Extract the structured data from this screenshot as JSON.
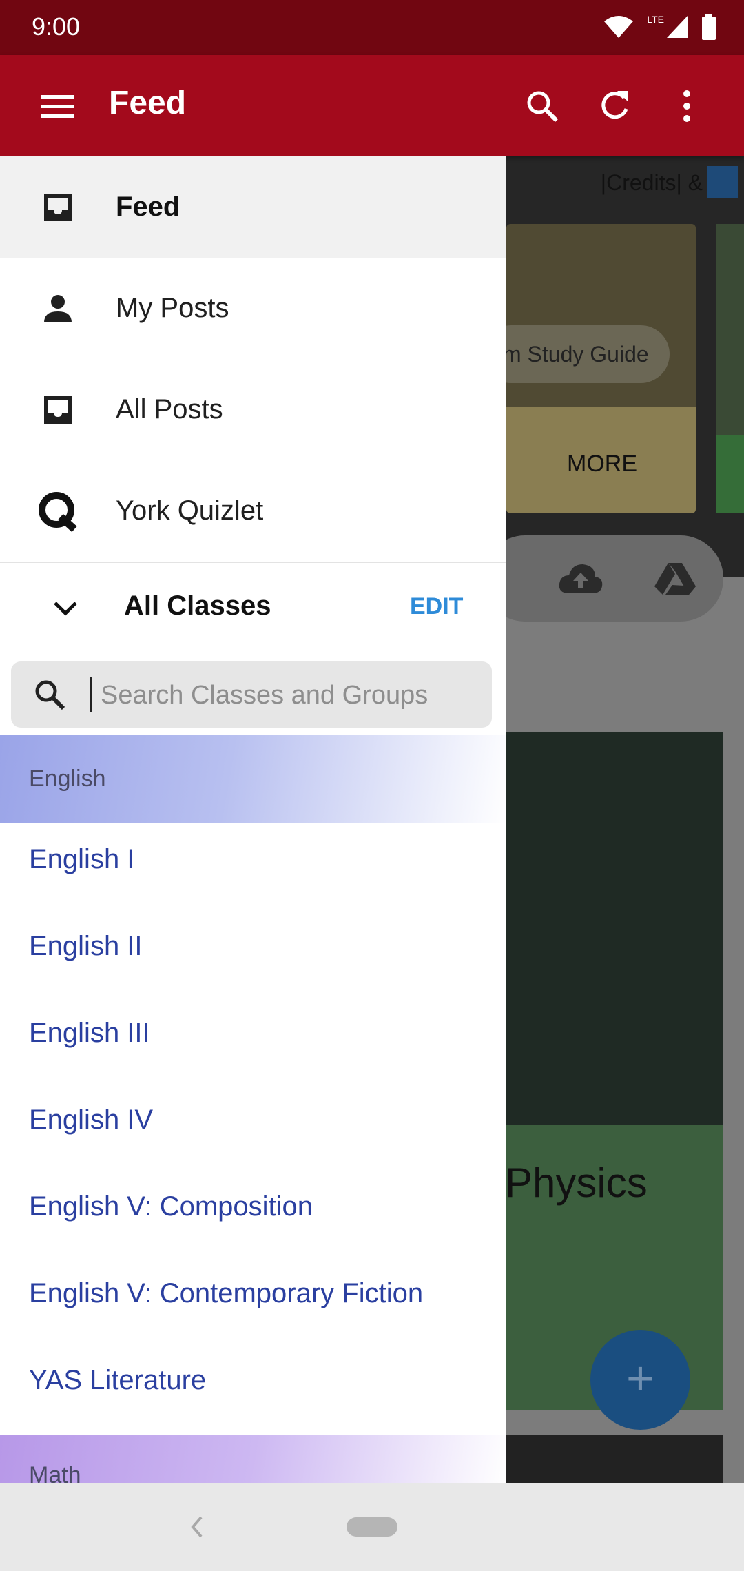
{
  "status_bar": {
    "time": "9:00",
    "network_label": "LTE"
  },
  "app_bar": {
    "title": "Feed",
    "icons": [
      "menu-icon",
      "search-icon",
      "refresh-icon",
      "more-vert-icon"
    ],
    "color": "#a30a1c"
  },
  "background": {
    "credits_text": "|Credits| &",
    "chip_text": "m Study Guide",
    "more_label": "MORE",
    "card_title": "Physics",
    "fab_label": "+"
  },
  "drawer": {
    "nav_items": [
      {
        "label": "Feed",
        "icon": "inbox-icon",
        "active": true
      },
      {
        "label": "My Posts",
        "icon": "person-icon",
        "active": false
      },
      {
        "label": "All Posts",
        "icon": "inbox-icon",
        "active": false
      },
      {
        "label": "York Quizlet",
        "icon": "quizlet-q-icon",
        "active": false
      }
    ],
    "classes_header": {
      "title": "All Classes",
      "edit_label": "EDIT"
    },
    "search": {
      "placeholder": "Search Classes and Groups",
      "value": ""
    },
    "groups": [
      {
        "name": "English",
        "classes": [
          "English I",
          "English II",
          "English III",
          "English IV",
          "English V: Composition",
          "English V: Contemporary Fiction",
          "YAS Literature"
        ]
      },
      {
        "name": "Math",
        "classes": []
      }
    ]
  },
  "colors": {
    "accent": "#2e8bd8",
    "class_link": "#2a3fa0",
    "status_bar": "#710611"
  }
}
